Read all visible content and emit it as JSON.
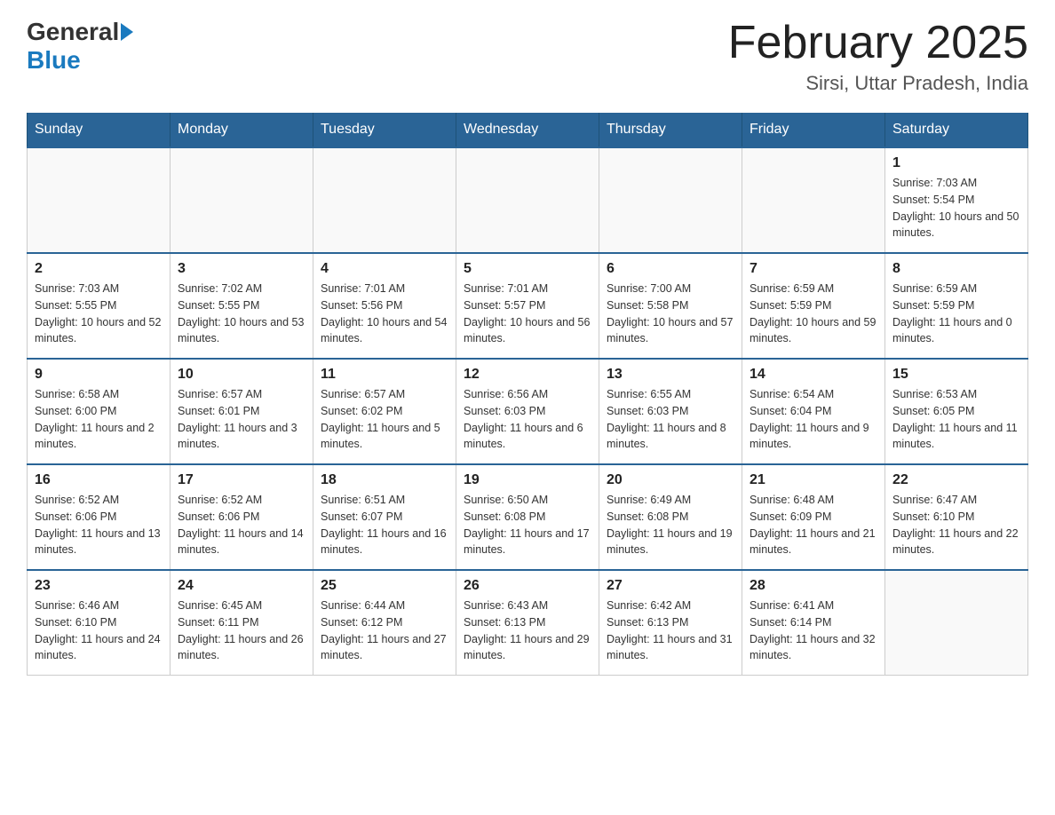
{
  "header": {
    "logo_general": "General",
    "logo_blue": "Blue",
    "month_title": "February 2025",
    "location": "Sirsi, Uttar Pradesh, India"
  },
  "weekdays": [
    "Sunday",
    "Monday",
    "Tuesday",
    "Wednesday",
    "Thursday",
    "Friday",
    "Saturday"
  ],
  "weeks": [
    [
      {
        "day": "",
        "sunrise": "",
        "sunset": "",
        "daylight": ""
      },
      {
        "day": "",
        "sunrise": "",
        "sunset": "",
        "daylight": ""
      },
      {
        "day": "",
        "sunrise": "",
        "sunset": "",
        "daylight": ""
      },
      {
        "day": "",
        "sunrise": "",
        "sunset": "",
        "daylight": ""
      },
      {
        "day": "",
        "sunrise": "",
        "sunset": "",
        "daylight": ""
      },
      {
        "day": "",
        "sunrise": "",
        "sunset": "",
        "daylight": ""
      },
      {
        "day": "1",
        "sunrise": "Sunrise: 7:03 AM",
        "sunset": "Sunset: 5:54 PM",
        "daylight": "Daylight: 10 hours and 50 minutes."
      }
    ],
    [
      {
        "day": "2",
        "sunrise": "Sunrise: 7:03 AM",
        "sunset": "Sunset: 5:55 PM",
        "daylight": "Daylight: 10 hours and 52 minutes."
      },
      {
        "day": "3",
        "sunrise": "Sunrise: 7:02 AM",
        "sunset": "Sunset: 5:55 PM",
        "daylight": "Daylight: 10 hours and 53 minutes."
      },
      {
        "day": "4",
        "sunrise": "Sunrise: 7:01 AM",
        "sunset": "Sunset: 5:56 PM",
        "daylight": "Daylight: 10 hours and 54 minutes."
      },
      {
        "day": "5",
        "sunrise": "Sunrise: 7:01 AM",
        "sunset": "Sunset: 5:57 PM",
        "daylight": "Daylight: 10 hours and 56 minutes."
      },
      {
        "day": "6",
        "sunrise": "Sunrise: 7:00 AM",
        "sunset": "Sunset: 5:58 PM",
        "daylight": "Daylight: 10 hours and 57 minutes."
      },
      {
        "day": "7",
        "sunrise": "Sunrise: 6:59 AM",
        "sunset": "Sunset: 5:59 PM",
        "daylight": "Daylight: 10 hours and 59 minutes."
      },
      {
        "day": "8",
        "sunrise": "Sunrise: 6:59 AM",
        "sunset": "Sunset: 5:59 PM",
        "daylight": "Daylight: 11 hours and 0 minutes."
      }
    ],
    [
      {
        "day": "9",
        "sunrise": "Sunrise: 6:58 AM",
        "sunset": "Sunset: 6:00 PM",
        "daylight": "Daylight: 11 hours and 2 minutes."
      },
      {
        "day": "10",
        "sunrise": "Sunrise: 6:57 AM",
        "sunset": "Sunset: 6:01 PM",
        "daylight": "Daylight: 11 hours and 3 minutes."
      },
      {
        "day": "11",
        "sunrise": "Sunrise: 6:57 AM",
        "sunset": "Sunset: 6:02 PM",
        "daylight": "Daylight: 11 hours and 5 minutes."
      },
      {
        "day": "12",
        "sunrise": "Sunrise: 6:56 AM",
        "sunset": "Sunset: 6:03 PM",
        "daylight": "Daylight: 11 hours and 6 minutes."
      },
      {
        "day": "13",
        "sunrise": "Sunrise: 6:55 AM",
        "sunset": "Sunset: 6:03 PM",
        "daylight": "Daylight: 11 hours and 8 minutes."
      },
      {
        "day": "14",
        "sunrise": "Sunrise: 6:54 AM",
        "sunset": "Sunset: 6:04 PM",
        "daylight": "Daylight: 11 hours and 9 minutes."
      },
      {
        "day": "15",
        "sunrise": "Sunrise: 6:53 AM",
        "sunset": "Sunset: 6:05 PM",
        "daylight": "Daylight: 11 hours and 11 minutes."
      }
    ],
    [
      {
        "day": "16",
        "sunrise": "Sunrise: 6:52 AM",
        "sunset": "Sunset: 6:06 PM",
        "daylight": "Daylight: 11 hours and 13 minutes."
      },
      {
        "day": "17",
        "sunrise": "Sunrise: 6:52 AM",
        "sunset": "Sunset: 6:06 PM",
        "daylight": "Daylight: 11 hours and 14 minutes."
      },
      {
        "day": "18",
        "sunrise": "Sunrise: 6:51 AM",
        "sunset": "Sunset: 6:07 PM",
        "daylight": "Daylight: 11 hours and 16 minutes."
      },
      {
        "day": "19",
        "sunrise": "Sunrise: 6:50 AM",
        "sunset": "Sunset: 6:08 PM",
        "daylight": "Daylight: 11 hours and 17 minutes."
      },
      {
        "day": "20",
        "sunrise": "Sunrise: 6:49 AM",
        "sunset": "Sunset: 6:08 PM",
        "daylight": "Daylight: 11 hours and 19 minutes."
      },
      {
        "day": "21",
        "sunrise": "Sunrise: 6:48 AM",
        "sunset": "Sunset: 6:09 PM",
        "daylight": "Daylight: 11 hours and 21 minutes."
      },
      {
        "day": "22",
        "sunrise": "Sunrise: 6:47 AM",
        "sunset": "Sunset: 6:10 PM",
        "daylight": "Daylight: 11 hours and 22 minutes."
      }
    ],
    [
      {
        "day": "23",
        "sunrise": "Sunrise: 6:46 AM",
        "sunset": "Sunset: 6:10 PM",
        "daylight": "Daylight: 11 hours and 24 minutes."
      },
      {
        "day": "24",
        "sunrise": "Sunrise: 6:45 AM",
        "sunset": "Sunset: 6:11 PM",
        "daylight": "Daylight: 11 hours and 26 minutes."
      },
      {
        "day": "25",
        "sunrise": "Sunrise: 6:44 AM",
        "sunset": "Sunset: 6:12 PM",
        "daylight": "Daylight: 11 hours and 27 minutes."
      },
      {
        "day": "26",
        "sunrise": "Sunrise: 6:43 AM",
        "sunset": "Sunset: 6:13 PM",
        "daylight": "Daylight: 11 hours and 29 minutes."
      },
      {
        "day": "27",
        "sunrise": "Sunrise: 6:42 AM",
        "sunset": "Sunset: 6:13 PM",
        "daylight": "Daylight: 11 hours and 31 minutes."
      },
      {
        "day": "28",
        "sunrise": "Sunrise: 6:41 AM",
        "sunset": "Sunset: 6:14 PM",
        "daylight": "Daylight: 11 hours and 32 minutes."
      },
      {
        "day": "",
        "sunrise": "",
        "sunset": "",
        "daylight": ""
      }
    ]
  ]
}
